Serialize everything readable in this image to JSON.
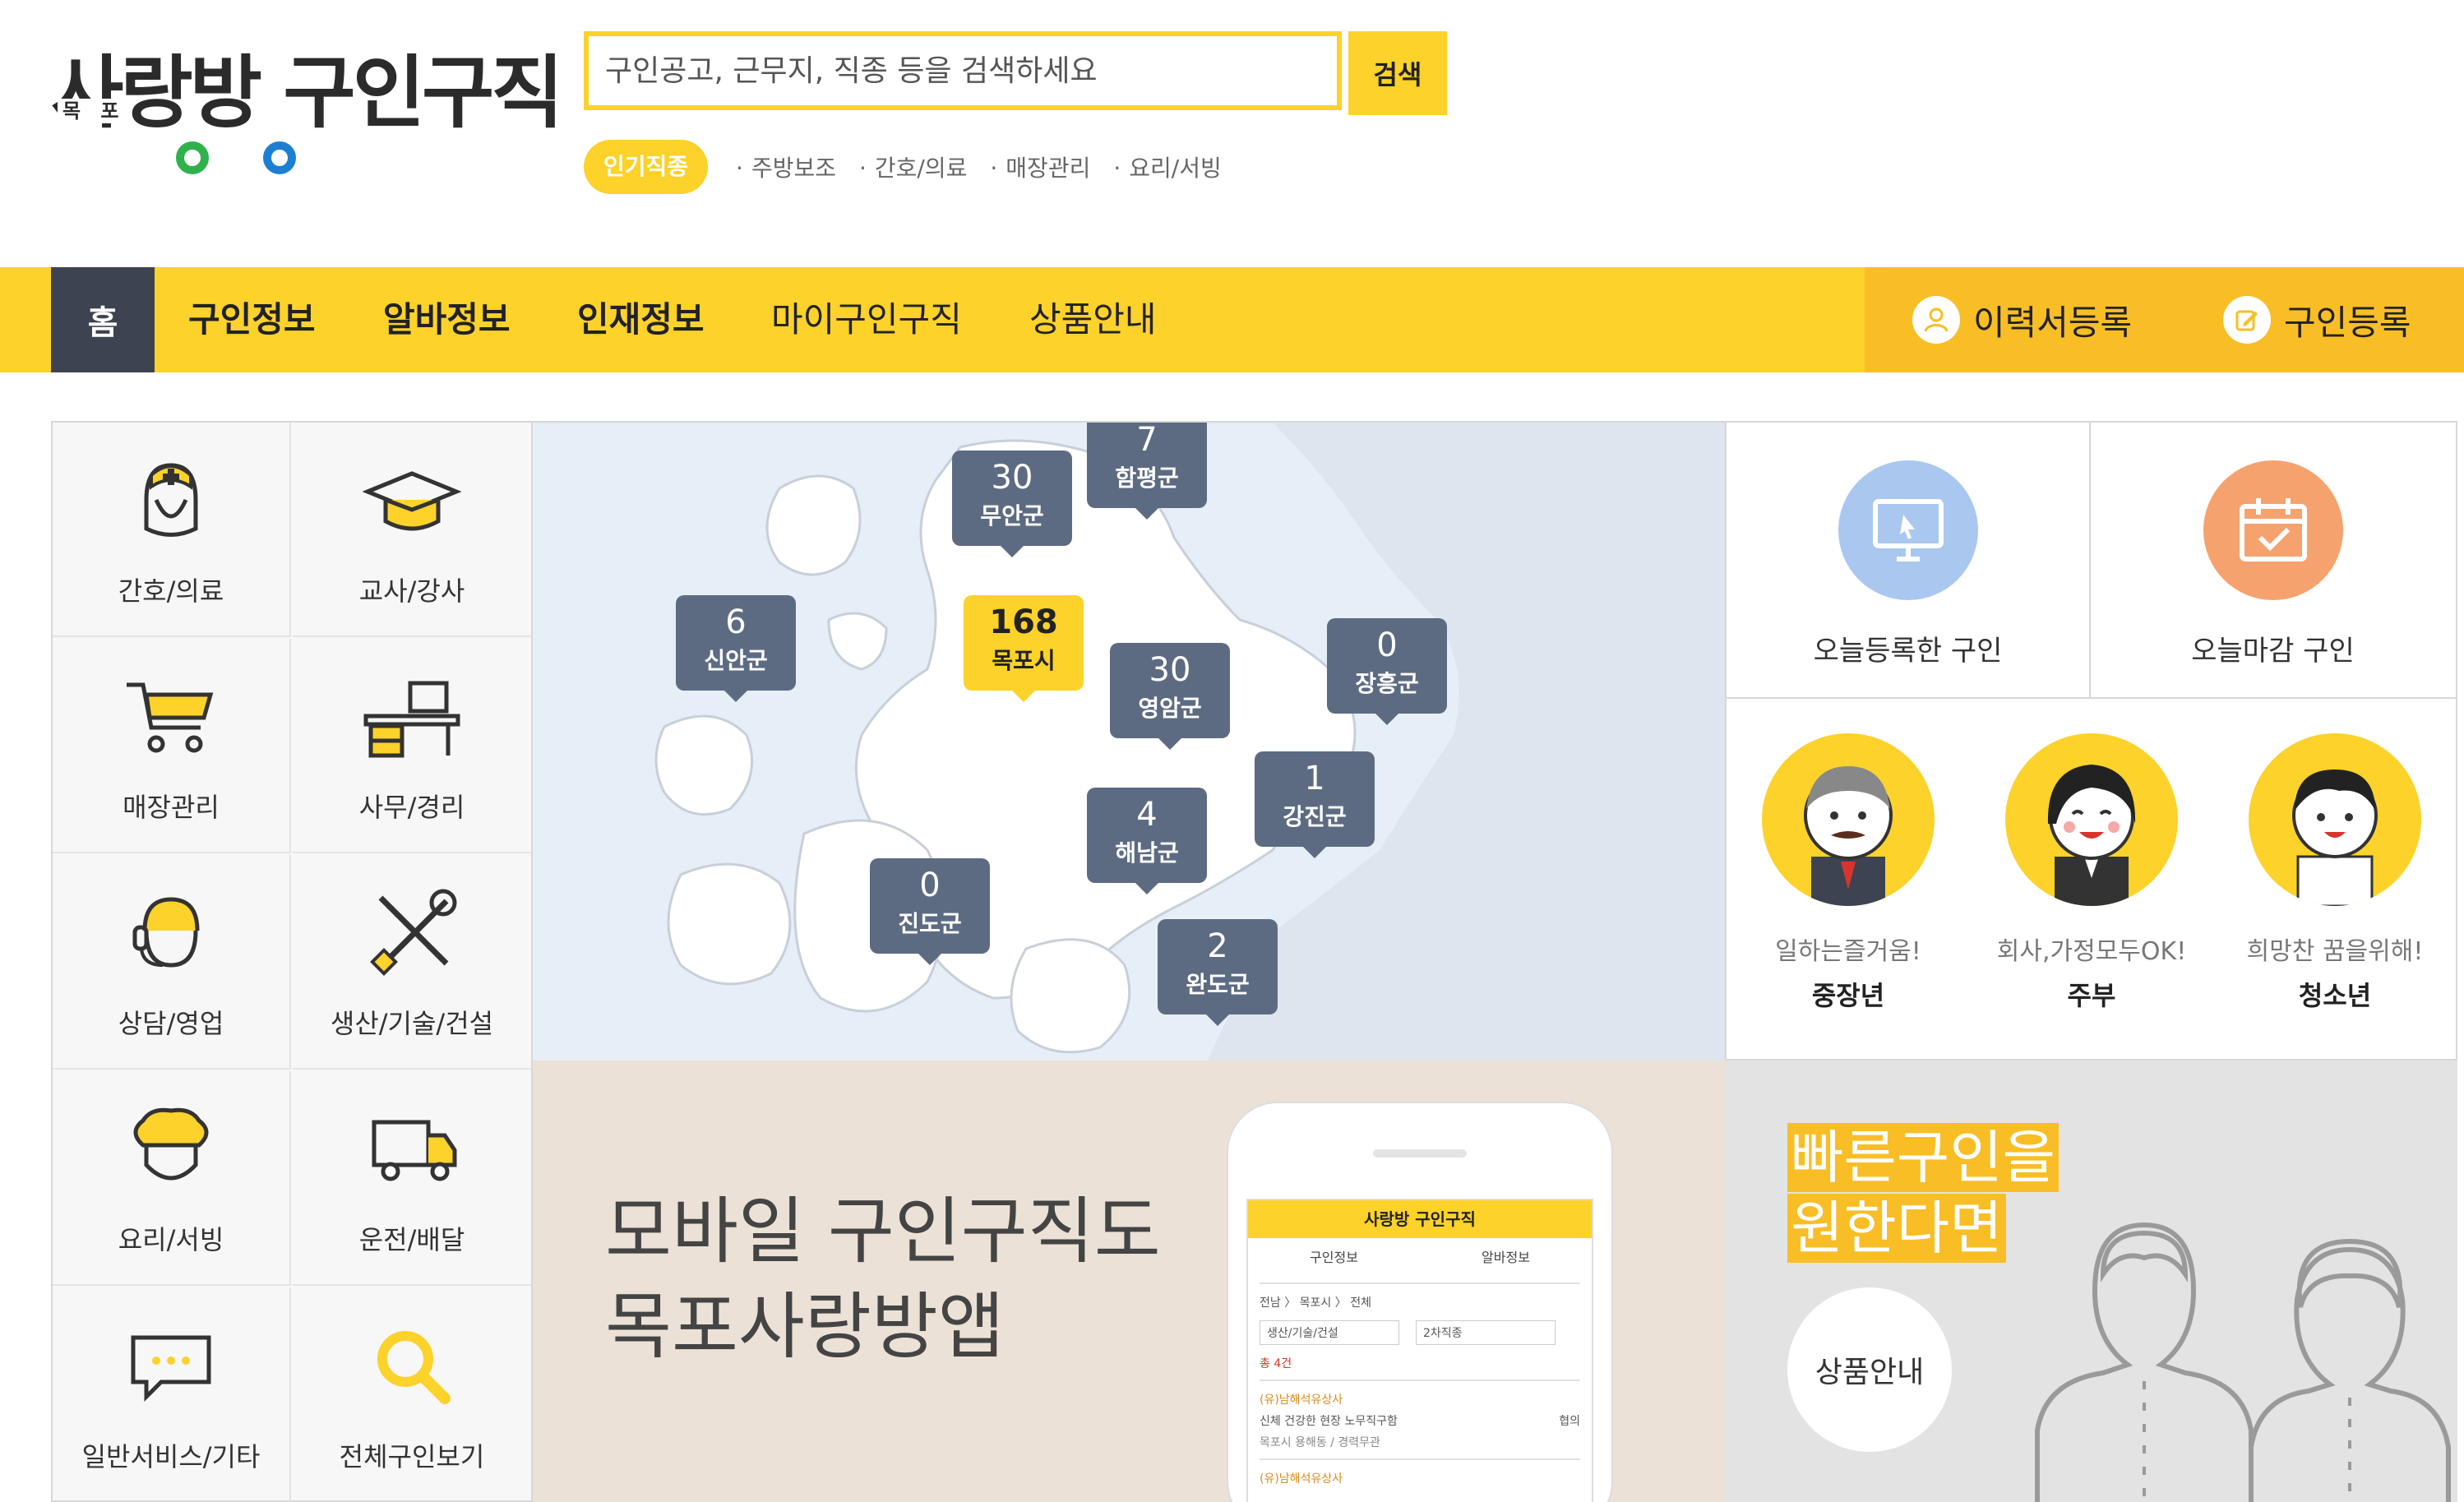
{
  "header": {
    "logo": {
      "main": "사랑방 구인구직",
      "sub": "목 포"
    },
    "search": {
      "placeholder": "구인공고, 근무지, 직종 등을 검색하세요",
      "button_label": "검색"
    },
    "popular": {
      "badge": "인기직종",
      "items": [
        "주방보조",
        "간호/의료",
        "매장관리",
        "요리/서빙"
      ]
    }
  },
  "nav": {
    "home": "홈",
    "items": [
      "구인정보",
      "알바정보",
      "인재정보",
      "마이구인구직",
      "상품안내"
    ],
    "right": [
      {
        "label": "이력서등록",
        "icon": "person-icon"
      },
      {
        "label": "구인등록",
        "icon": "edit-icon"
      }
    ]
  },
  "categories": [
    {
      "label": "간호/의료",
      "icon": "nurse-icon"
    },
    {
      "label": "교사/강사",
      "icon": "graduation-cap-icon"
    },
    {
      "label": "매장관리",
      "icon": "shopping-cart-icon"
    },
    {
      "label": "사무/경리",
      "icon": "office-desk-icon"
    },
    {
      "label": "상담/영업",
      "icon": "headset-icon"
    },
    {
      "label": "생산/기술/건설",
      "icon": "tools-icon"
    },
    {
      "label": "요리/서빙",
      "icon": "chef-hat-icon"
    },
    {
      "label": "운전/배달",
      "icon": "truck-icon"
    },
    {
      "label": "일반서비스/기타",
      "icon": "chat-bubble-icon"
    },
    {
      "label": "전체구인보기",
      "icon": "search-icon"
    }
  ],
  "map": {
    "regions": [
      {
        "name": "무안군",
        "count": "30"
      },
      {
        "name": "함평군",
        "count": "7"
      },
      {
        "name": "신안군",
        "count": "6"
      },
      {
        "name": "목포시",
        "count": "168"
      },
      {
        "name": "영암군",
        "count": "30"
      },
      {
        "name": "장흥군",
        "count": "0"
      },
      {
        "name": "강진군",
        "count": "1"
      },
      {
        "name": "해남군",
        "count": "4"
      },
      {
        "name": "진도군",
        "count": "0"
      },
      {
        "name": "완도군",
        "count": "2"
      }
    ]
  },
  "quick": {
    "today_registered": "오늘등록한 구인",
    "today_closing": "오늘마감 구인",
    "personas": [
      {
        "tag": "일하는즐거움!",
        "title": "중장년"
      },
      {
        "tag": "회사,가정모두OK!",
        "title": "주부"
      },
      {
        "tag": "희망찬 꿈을위해!",
        "title": "청소년"
      }
    ]
  },
  "banners": {
    "app": {
      "line1": "모바일 구인구직도",
      "line2": "목포사랑방앱",
      "phone": {
        "title": "사랑방 구인구직",
        "tabs": [
          "구인정보",
          "알바정보"
        ],
        "breadcrumb": "전남 〉 목포시 〉 전체",
        "filter1": "생산/기술/건설",
        "filter2": "2차직종",
        "count": "총 4건",
        "company": "(유)남해석유상사",
        "post_title": "신체 건강한 현장 노무직구함",
        "post_meta": "목포시 용해동 / 경력무관",
        "post_pay": "협의",
        "company2": "(유)남해석유상사"
      }
    },
    "hire": {
      "line1": "빠른구인을",
      "line2": "원한다면",
      "button": "상품안내"
    }
  },
  "colors": {
    "brand_yellow": "#fcd22b",
    "nav_right": "#f9be26",
    "home_bg": "#3d4350",
    "pin": "#5d6b82",
    "map_bg": "#e6eef8",
    "quick_blue": "#a9c7ef",
    "quick_orange": "#f6a26e"
  }
}
